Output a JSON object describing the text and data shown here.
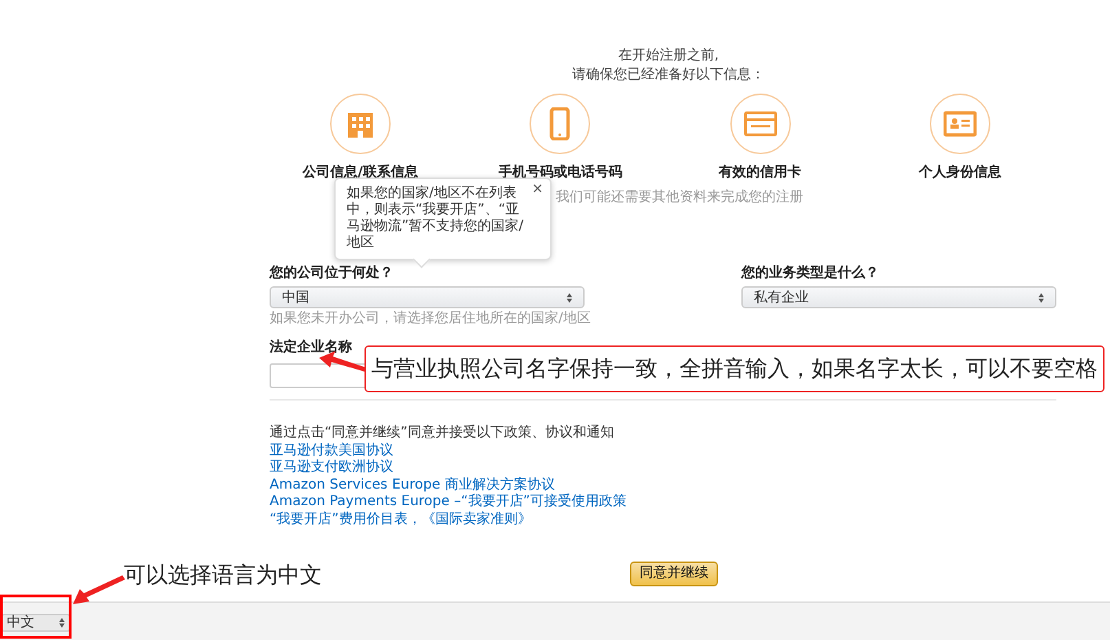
{
  "intro": [
    "在开始注册之前,",
    "请确保您已经准备好以下信息："
  ],
  "requirements": [
    {
      "kind": "building",
      "label": "公司信息/联系信息"
    },
    {
      "kind": "phone",
      "label": "手机号码或电话号码"
    },
    {
      "kind": "card",
      "label": "有效的信用卡"
    },
    {
      "kind": "id",
      "label": "个人身份信息"
    }
  ],
  "note": "我们可能还需要其他资料来完成您的注册",
  "tooltip": {
    "text": "如果您的国家/地区不在列表中，则表示“我要开店”、“亚马逊物流”暂不支持您的国家/地区",
    "close": "×"
  },
  "country": {
    "label": "您的公司位于何处？",
    "value": "中国",
    "hint": "如果您未开办公司，请选择您居住地所在的国家/地区"
  },
  "business_type": {
    "label": "您的业务类型是什么？",
    "value": "私有企业"
  },
  "legal_name": {
    "label": "法定企业名称"
  },
  "terms": {
    "intro": "通过点击“同意并继续”同意并接受以下政策、协议和通知",
    "links": [
      "亚马逊付款美国协议",
      "亚马逊支付欧洲协议",
      "Amazon Services Europe 商业解决方案协议",
      "Amazon Payments Europe –“我要开店”可接受使用政策",
      "“我要开店”费用价目表，《国际卖家准则》"
    ]
  },
  "continue_button": "同意并继续",
  "language": {
    "value": "中文"
  },
  "annotations": [
    {
      "text": "与营业执照公司名字保持一致，全拼音输入，如果名字太长，可以不要空格"
    },
    {
      "text": "可以选择语言为中文"
    }
  ]
}
